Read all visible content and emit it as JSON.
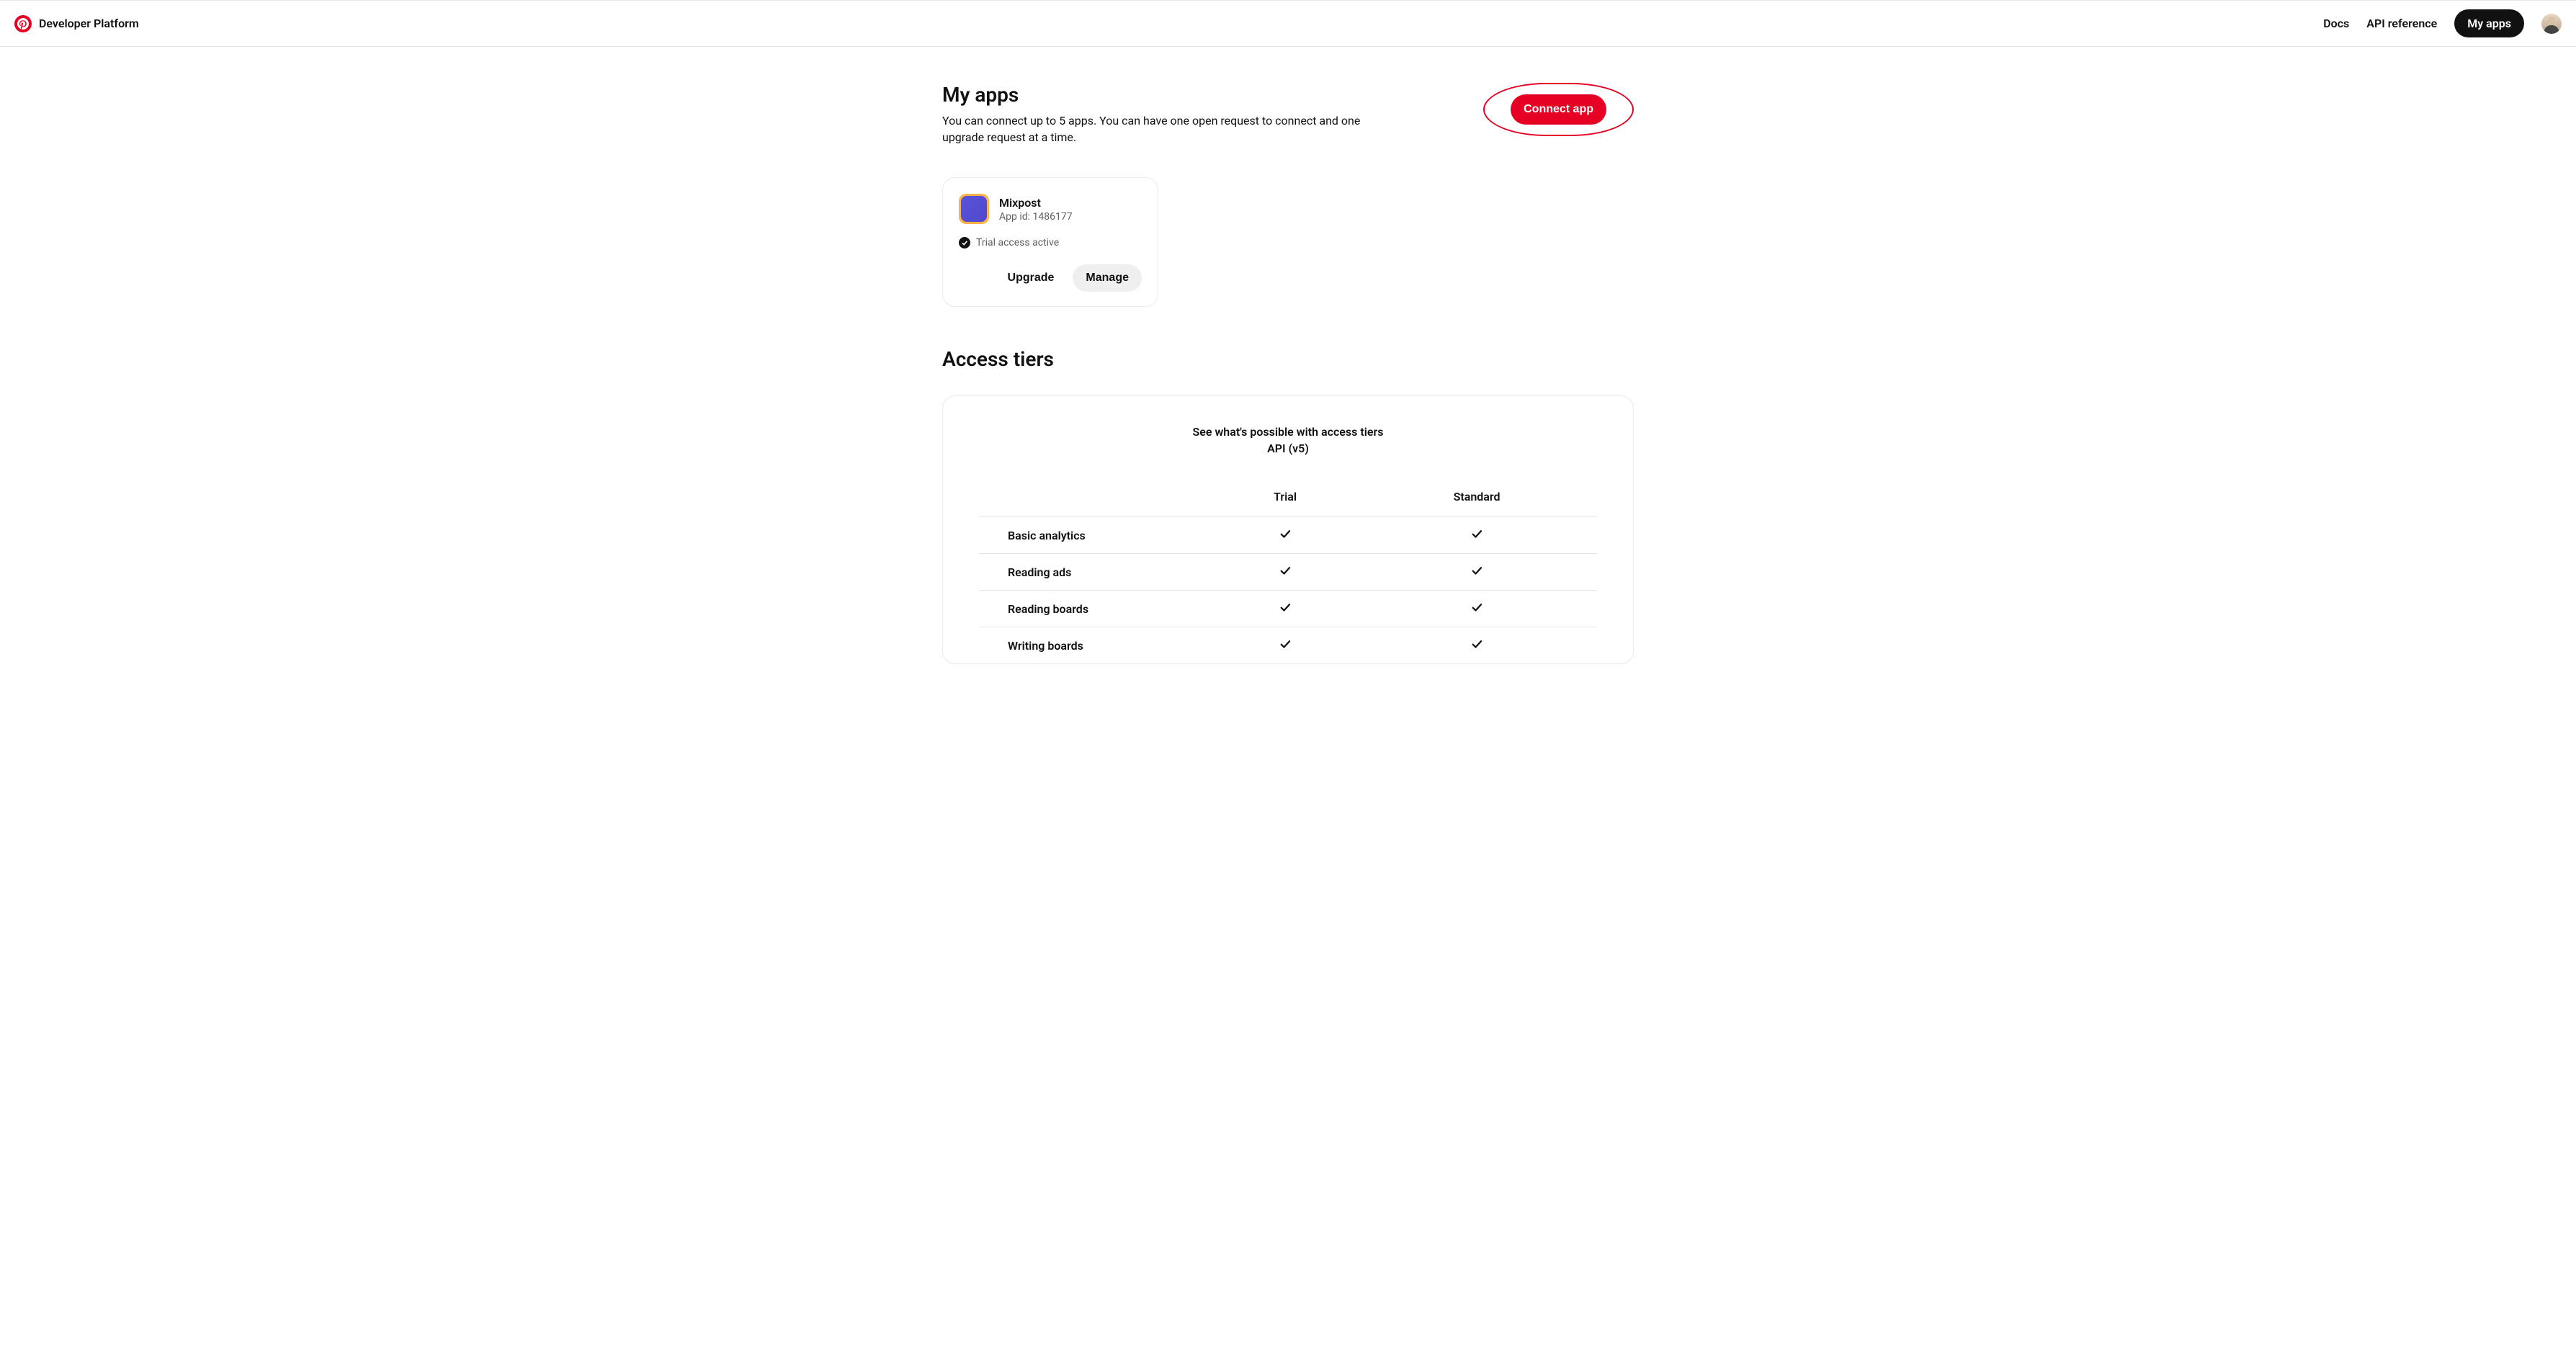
{
  "header": {
    "platform_title": "Developer Platform",
    "nav": {
      "docs": "Docs",
      "api_reference": "API reference",
      "my_apps": "My apps"
    }
  },
  "page": {
    "title": "My apps",
    "subtitle": "You can connect up to 5 apps. You can have one open request to connect and one upgrade request at a time.",
    "connect_label": "Connect app"
  },
  "app_card": {
    "name": "Mixpost",
    "id_label": "App id: 1486177",
    "status": "Trial access active",
    "upgrade_label": "Upgrade",
    "manage_label": "Manage"
  },
  "tiers": {
    "section_title": "Access tiers",
    "head_line1": "See what's possible with access tiers",
    "head_line2": "API (v5)",
    "columns": {
      "feature": "",
      "trial": "Trial",
      "standard": "Standard"
    },
    "rows": [
      {
        "feature": "Basic analytics",
        "trial": true,
        "standard": true
      },
      {
        "feature": "Reading ads",
        "trial": true,
        "standard": true
      },
      {
        "feature": "Reading boards",
        "trial": true,
        "standard": true
      },
      {
        "feature": "Writing boards",
        "trial": true,
        "standard": true
      }
    ]
  }
}
